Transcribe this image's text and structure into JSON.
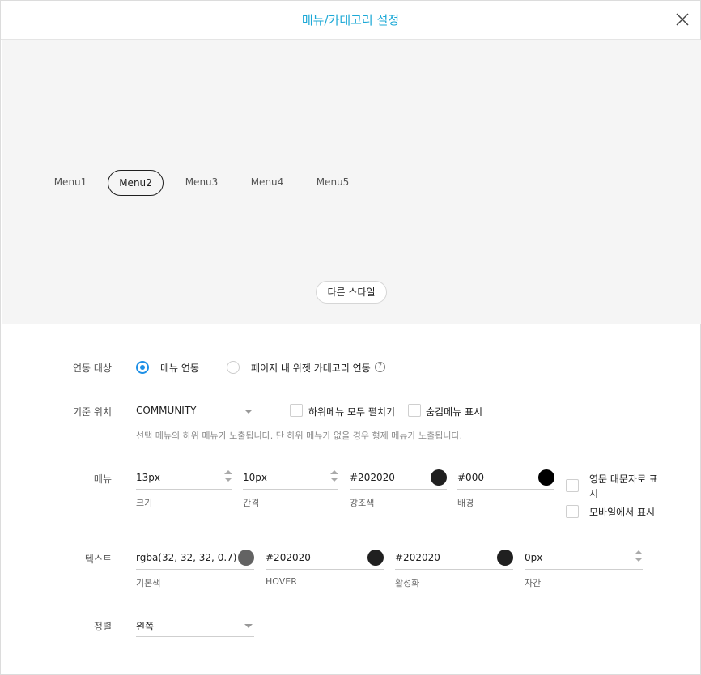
{
  "header": {
    "title": "메뉴/카테고리 설정"
  },
  "preview": {
    "menu_items": [
      "Menu1",
      "Menu2",
      "Menu3",
      "Menu4",
      "Menu5"
    ],
    "active_index": 1,
    "other_style_label": "다른 스타일"
  },
  "link": {
    "label": "연동 대상",
    "options": [
      "메뉴 연동",
      "페이지 내 위젯 카테고리 연동"
    ],
    "selected": "메뉴 연동",
    "help_glyph": "?"
  },
  "base": {
    "label": "기준 위치",
    "value": "COMMUNITY",
    "expand_all_label": "하위메뉴 모두 펼치기",
    "show_hidden_label": "숨김메뉴 표시",
    "hint": "선택 메뉴의 하위 메뉴가 노출됩니다. 단 하위 메뉴가 없을 경우 형제 메뉴가 노출됩니다."
  },
  "menu": {
    "label": "메뉴",
    "size": {
      "value": "13px",
      "caption": "크기"
    },
    "gap": {
      "value": "10px",
      "caption": "간격"
    },
    "accent": {
      "value": "#202020",
      "caption": "강조색",
      "color": "#202020"
    },
    "bg": {
      "value": "#000",
      "caption": "배경",
      "color": "#000000"
    },
    "uppercase_label": "영문 대문자로 표시",
    "mobile_label": "모바일에서 표시"
  },
  "text": {
    "label": "텍스트",
    "base_color": {
      "value": "rgba(32, 32, 32, 0.7)",
      "caption": "기본색",
      "color": "#636363"
    },
    "hover": {
      "value": "#202020",
      "caption": "HOVER",
      "color": "#202020"
    },
    "active": {
      "value": "#202020",
      "caption": "활성화",
      "color": "#202020"
    },
    "spacing": {
      "value": "0px",
      "caption": "자간"
    }
  },
  "align": {
    "label": "정렬",
    "value": "왼쪽"
  },
  "colors": {
    "accent": "#1ba8d6",
    "radio_on": "#1e90e6"
  }
}
